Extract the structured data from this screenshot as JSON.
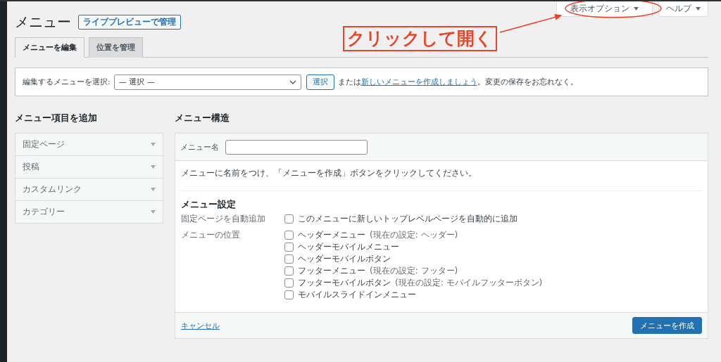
{
  "screen_meta": [
    {
      "label": "表示オプション"
    },
    {
      "label": "ヘルプ"
    }
  ],
  "annotation": {
    "text": "クリックして開く"
  },
  "title": "メニュー",
  "title_action": "ライブプレビューで管理",
  "tabs": [
    {
      "label": "メニューを編集",
      "selected": true
    },
    {
      "label": "位置を管理",
      "selected": false
    }
  ],
  "select_bar": {
    "label": "編集するメニューを選択:",
    "select_value": "— 選択 —",
    "button": "選択",
    "text_before": "または",
    "link": "新しいメニューを作成しましょう",
    "text_after": "。変更の保存をお忘れなく。"
  },
  "add_items": {
    "heading": "メニュー項目を追加",
    "sections": [
      {
        "label": "固定ページ"
      },
      {
        "label": "投稿"
      },
      {
        "label": "カスタムリンク"
      },
      {
        "label": "カテゴリー"
      }
    ]
  },
  "structure": {
    "heading": "メニュー構造",
    "name_label": "メニュー名",
    "instructions": "メニューに名前をつけ、「メニューを作成」ボタンをクリックしてください。",
    "settings_heading": "メニュー設定",
    "settings": [
      {
        "label": "固定ページを自動追加",
        "options": [
          {
            "label": "このメニューに新しいトップレベルページを自動的に追加",
            "checked": false
          }
        ]
      },
      {
        "label": "メニューの位置",
        "options": [
          {
            "label": "ヘッダーメニュー",
            "note": "(現在の設定: ヘッダー)",
            "checked": false
          },
          {
            "label": "ヘッダーモバイルメニュー",
            "checked": false
          },
          {
            "label": "ヘッダーモバイルボタン",
            "checked": false
          },
          {
            "label": "フッターメニュー",
            "note": "(現在の設定: フッター)",
            "checked": false
          },
          {
            "label": "フッターモバイルボタン",
            "note": "(現在の設定: モバイルフッターボタン)",
            "checked": false
          },
          {
            "label": "モバイルスライドインメニュー",
            "checked": false
          }
        ]
      }
    ],
    "cancel": "キャンセル",
    "create_button": "メニューを作成"
  }
}
